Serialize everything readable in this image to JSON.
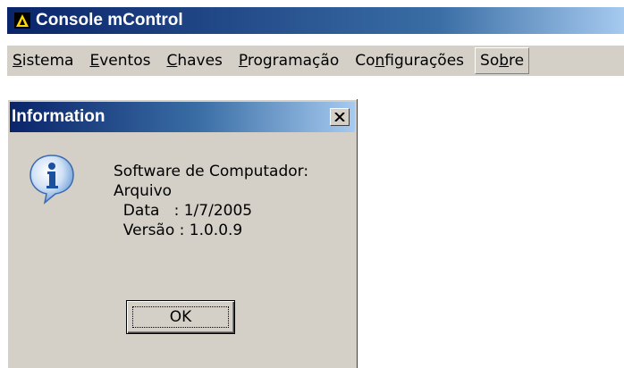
{
  "app": {
    "title": "Console mControl",
    "icon": "app-triangle-icon"
  },
  "menu": {
    "items": [
      {
        "pre": "",
        "key": "S",
        "post": "istema"
      },
      {
        "pre": "",
        "key": "E",
        "post": "ventos"
      },
      {
        "pre": "",
        "key": "C",
        "post": "haves"
      },
      {
        "pre": "",
        "key": "P",
        "post": "rogramação"
      },
      {
        "pre": "Co",
        "key": "n",
        "post": "figurações"
      },
      {
        "pre": "So",
        "key": "b",
        "post": "re"
      }
    ],
    "active_index": 5
  },
  "dialog": {
    "title": "Information",
    "close_label": "×",
    "icon": "information-icon",
    "message": "Software de Computador:\nArquivo\n  Data   : 1/7/2005\n  Versão : 1.0.0.9",
    "ok_label": "OK"
  },
  "colors": {
    "titlebar_start": "#0a246a",
    "titlebar_end": "#a6caf0",
    "face": "#d4d0c8"
  }
}
